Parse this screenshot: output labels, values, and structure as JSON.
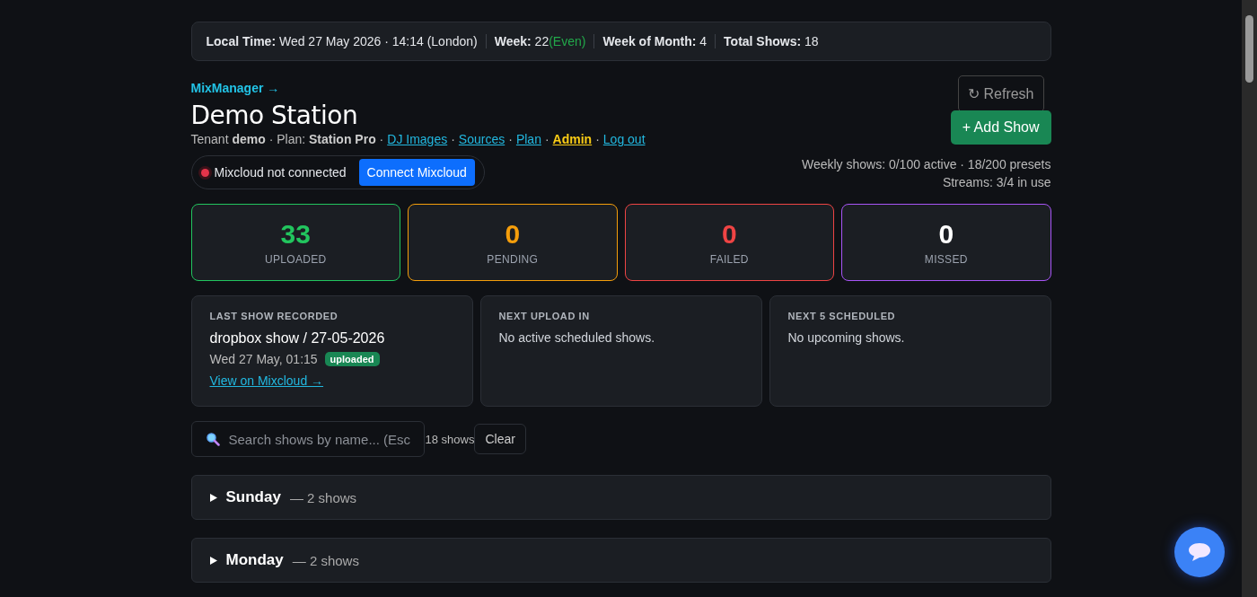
{
  "status_bar": [
    {
      "label": "Local Time:",
      "value": "Wed 27 May 2026 · 14:14 (London)"
    },
    {
      "label": "Week:",
      "value": "22",
      "note": "(Even)"
    },
    {
      "label": "Week of Month:",
      "value": "4"
    },
    {
      "label": "Total Shows:",
      "value": "18"
    }
  ],
  "brand_link": "MixManager →",
  "title": "Demo Station",
  "tenant_line": "Tenant **demo** · Plan: **Station Pro** ·",
  "nav_links": [
    {
      "label": "DJ Images",
      "kind": "normal",
      "separator": "·"
    },
    {
      "label": "Sources",
      "kind": "normal",
      "separator": "·"
    },
    {
      "label": "Plan",
      "kind": "normal",
      "separator": "·"
    },
    {
      "label": "Admin",
      "kind": "admin",
      "separator": "·"
    },
    {
      "label": "Log out",
      "kind": "normal"
    }
  ],
  "mixcloud": {
    "connected": false,
    "status": "Mixcloud not connected",
    "button": "Connect Mixcloud"
  },
  "buttons": {
    "refresh": "↻ Refresh",
    "add": "+ Add Show"
  },
  "usage": [
    "Weekly shows: 0/100 active · 18/200 presets",
    "Streams: 3/4 in use"
  ],
  "stats": [
    {
      "value": "33",
      "label": "UPLOADED",
      "color": "#22c55e"
    },
    {
      "value": "0",
      "label": "PENDING",
      "color": "#f59e0b"
    },
    {
      "value": "0",
      "label": "FAILED",
      "color": "#ef4444"
    },
    {
      "value": "0",
      "label": "MISSED",
      "color": "#a855f7"
    }
  ],
  "info_cards": [
    {
      "kind": "last",
      "heading": "LAST SHOW RECORDED",
      "title": "dropbox show / 27-05-2026",
      "time": "Wed 27 May, 01:15",
      "badge": "uploaded",
      "link": "View on Mixcloud →"
    },
    {
      "kind": "message",
      "heading": "NEXT UPLOAD IN",
      "text": "No active scheduled shows."
    },
    {
      "kind": "message",
      "heading": "NEXT 5 SCHEDULED",
      "text": "No upcoming shows."
    }
  ],
  "search": {
    "placeholder": "Search shows by name... (Esc",
    "count": "18 shows",
    "clear": "Clear"
  },
  "days": [
    {
      "name": "Sunday",
      "count": "— 2 shows",
      "expanded": false
    },
    {
      "name": "Monday",
      "count": "— 2 shows",
      "expanded": false
    }
  ]
}
